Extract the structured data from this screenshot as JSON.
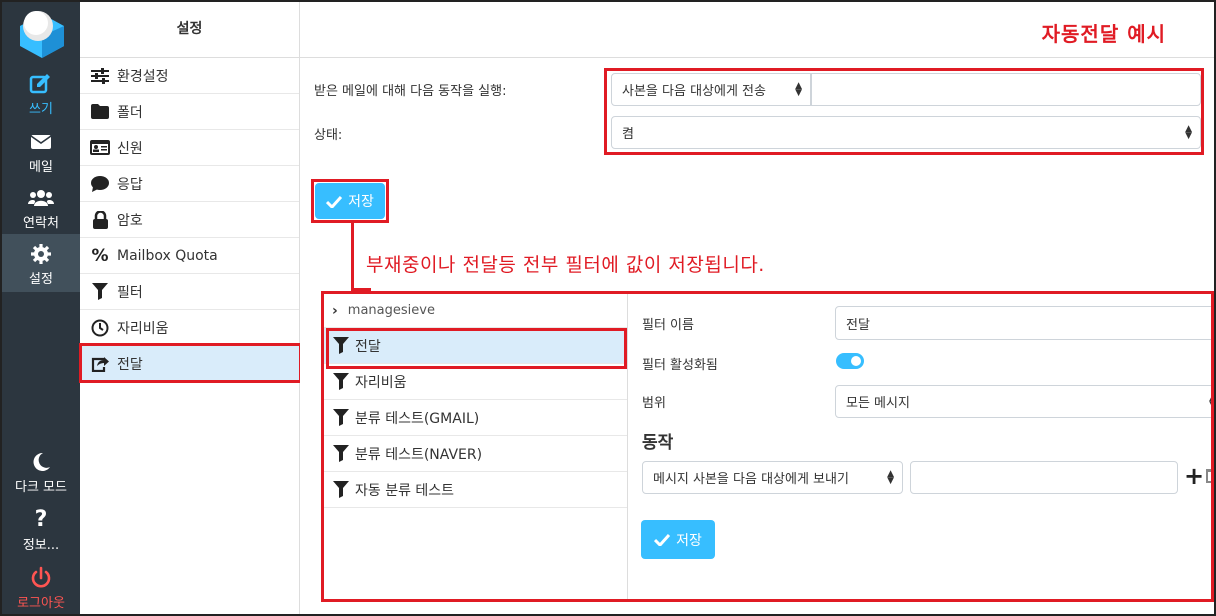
{
  "nav": {
    "compose": "쓰기",
    "mail": "메일",
    "contacts": "연락처",
    "settings": "설정",
    "dark_mode": "다크 모드",
    "about": "정보...",
    "logout": "로그아웃"
  },
  "settings_panel": {
    "title": "설정",
    "items": [
      {
        "label": "환경설정",
        "icon": "sliders-icon"
      },
      {
        "label": "폴더",
        "icon": "folder-icon"
      },
      {
        "label": "신원",
        "icon": "id-card-icon"
      },
      {
        "label": "응답",
        "icon": "comment-icon"
      },
      {
        "label": "암호",
        "icon": "lock-icon"
      },
      {
        "label": "Mailbox Quota",
        "icon": "percent-icon"
      },
      {
        "label": "필터",
        "icon": "filter-icon"
      },
      {
        "label": "자리비움",
        "icon": "clock-icon"
      },
      {
        "label": "전달",
        "icon": "share-icon",
        "selected": true
      }
    ]
  },
  "main": {
    "example_title": "자동전달 예시",
    "action_label": "받은 메일에 대해 다음 동작을 실행:",
    "action_value": "사본을 다음 대상에게 전송",
    "action_target": "",
    "status_label": "상태:",
    "status_value": "켬",
    "save": "저장",
    "note": "부재중이나 전달등 전부 필터에 값이 저장됩니다."
  },
  "filters": {
    "set_name": "managesieve",
    "items": [
      {
        "label": "전달",
        "selected": true
      },
      {
        "label": "자리비움"
      },
      {
        "label": "분류 테스트(GMAIL)"
      },
      {
        "label": "분류 테스트(NAVER)"
      },
      {
        "label": "자동 분류 테스트"
      }
    ]
  },
  "filter_detail": {
    "name_label": "필터 이름",
    "name_value": "전달",
    "enabled_label": "필터 활성화됨",
    "enabled": true,
    "scope_label": "범위",
    "scope_value": "모든 메시지",
    "action_title": "동작",
    "action_value": "메시지 사본을 다음 대상에게 보내기",
    "action_target": "",
    "save": "저장"
  },
  "colors": {
    "accent": "#37beff",
    "nav_bg": "#2c363f",
    "highlight": "#e01b24"
  }
}
